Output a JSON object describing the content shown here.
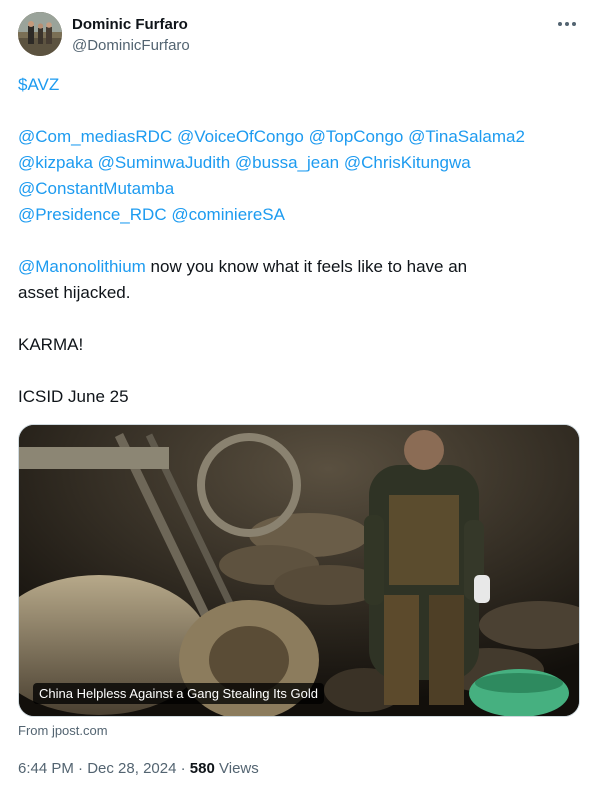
{
  "author": {
    "display_name": "Dominic Furfaro",
    "handle": "@DominicFurfaro"
  },
  "tweet": {
    "cashtag": "$AVZ",
    "mentions_line1": [
      "@Com_mediasRDC",
      "@VoiceOfCongo",
      "@TopCongo",
      "@TinaSalama2"
    ],
    "mentions_line2": [
      "@kizpaka",
      "@SuminwaJudith",
      "@bussa_jean",
      "@ChrisKitungwa"
    ],
    "mentions_line3": [
      "@ConstantMutamba"
    ],
    "mentions_line4": [
      "@Presidence_RDC",
      "@cominiereSA"
    ],
    "reply_mention": "@Manonolithium",
    "reply_text_1": " now you know what it feels like to have an",
    "reply_text_2": "asset hijacked.",
    "karma": "KARMA!",
    "icsid": "ICSID June 25"
  },
  "card": {
    "title": "China Helpless Against a Gang Stealing Its Gold",
    "source": "From jpost.com"
  },
  "meta": {
    "time": "6:44 PM",
    "separator": "·",
    "date": "Dec 28, 2024",
    "views_count": "580",
    "views_label": "Views"
  },
  "colors": {
    "link": "#1d9bf0",
    "secondary_text": "#536471",
    "primary_text": "#0f1419"
  },
  "icons": {
    "more": "more-dots-icon"
  }
}
